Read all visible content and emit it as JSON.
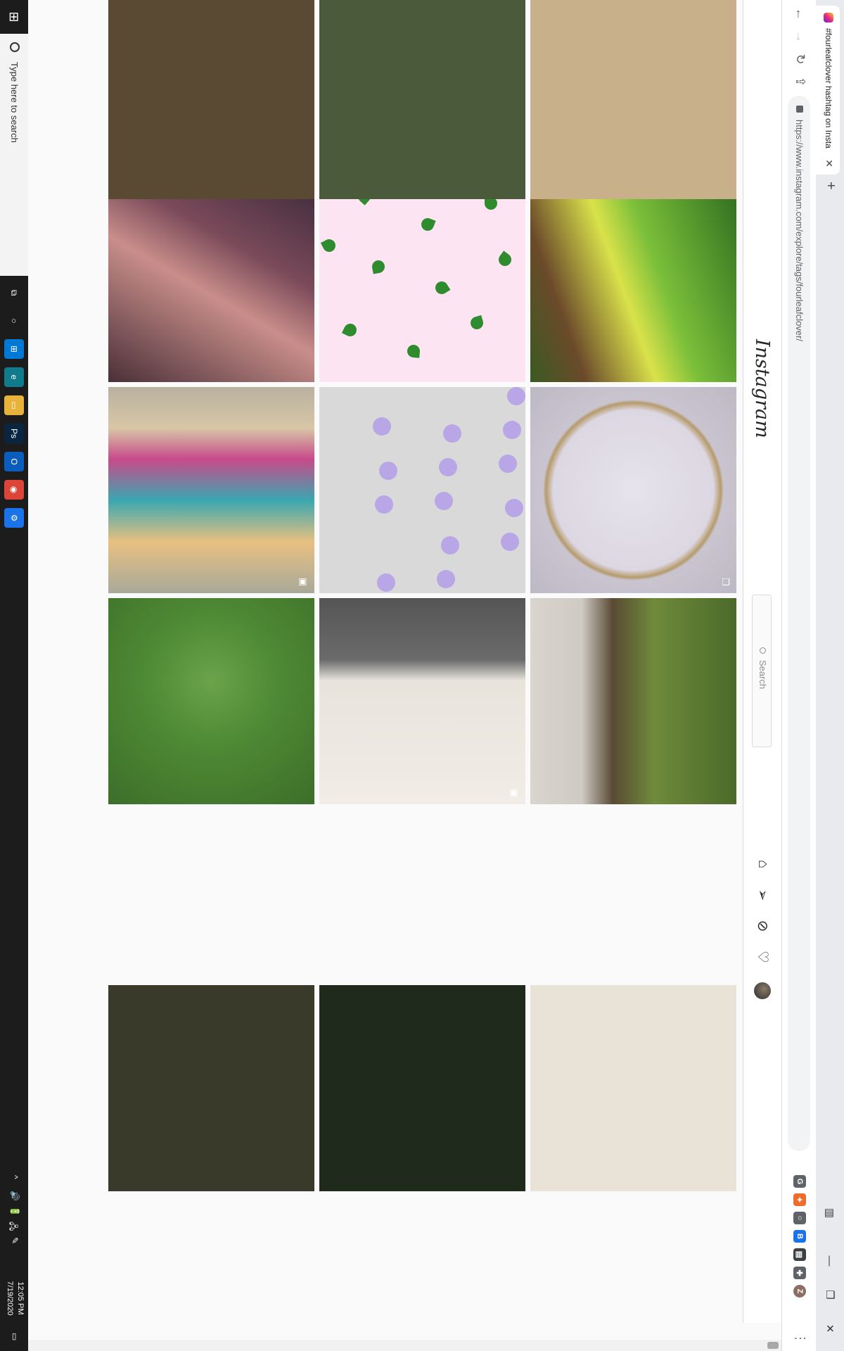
{
  "browser": {
    "tab_title": "#fourleafclover hashtag on Insta",
    "tab_close": "✕",
    "new_tab": "+",
    "url": "https://www.instagram.com/explore/tags/fourleafclover/",
    "window_controls": {
      "minimize": "—",
      "restore": "❐",
      "close": "✕"
    },
    "nav": {
      "back": "←",
      "forward": "→",
      "reload": "↻",
      "share": "⇪"
    },
    "extensions": [
      {
        "name": "extension-g",
        "label": "G",
        "color": "#5f6368"
      },
      {
        "name": "extension-orange",
        "label": "✦",
        "color": "#ef6c2a"
      },
      {
        "name": "extension-circle",
        "label": "○",
        "color": "#5f6368"
      },
      {
        "name": "extension-blue",
        "label": "B",
        "color": "#1a73e8"
      },
      {
        "name": "extension-dark",
        "label": "▤",
        "color": "#3c4043"
      },
      {
        "name": "extensions-puzzle",
        "label": "✚",
        "color": "#5f6368"
      },
      {
        "name": "profile",
        "label": "Z",
        "color": "#8d6e63"
      }
    ],
    "menu": "⋮"
  },
  "instagram": {
    "logo": "Instagram",
    "search_placeholder": "Search",
    "nav_icons": [
      "home-icon",
      "direct-icon",
      "explore-icon",
      "activity-icon",
      "profile-avatar"
    ]
  },
  "posts": [
    {
      "name": "post-selfie-woman",
      "glyph": "",
      "bg": "linear-gradient(120deg,#3b2a3a 0%,#7a4a5a 35%,#c98e8a 55%,#4a3038 100%)"
    },
    {
      "name": "post-clover-pattern-pink",
      "glyph": "",
      "bg": "#fde4f2"
    },
    {
      "name": "post-man-in-plants",
      "glyph": "",
      "bg": "linear-gradient(160deg,#2f6b1f 0%,#7bbf3a 40%,#d9e24a 55%,#6b4a2a 80%,#3b5a22 100%)"
    },
    {
      "name": "post-group-photo",
      "glyph": "▣",
      "bg": "linear-gradient(90deg,#b9b1a0 0%,#d8c6a6 20%,#c84a8a 35%,#3aa7b0 55%,#e8c080 75%,#a8a99a 100%)"
    },
    {
      "name": "post-pandora-castle",
      "glyph": "",
      "bg": "#d9d9d9"
    },
    {
      "name": "post-speckled-plate",
      "glyph": "❐",
      "bg": "radial-gradient(circle at 50% 50%,#e6e3ec 0%,#dcd7e2 55%,#b59a6a 60%,#c9c4cf 62%,#bdb9c4 100%)"
    },
    {
      "name": "post-clovers-in-hand",
      "glyph": "",
      "bg": "radial-gradient(circle at 40% 50%,#6aa34a 0%,#4f8a34 40%,#3c6e2a 100%)"
    },
    {
      "name": "post-framed-bird-art",
      "glyph": "▣",
      "bg": "linear-gradient(90deg,#555 0%,#6b6b6b 30%,#e8e4dc 40%,#f1ece6 100%)"
    },
    {
      "name": "post-clover-on-ground",
      "glyph": "",
      "bg": "linear-gradient(180deg,#4b6a2a 0%,#6f8a3a 40%,#5a4a34 60%,#cfcac4 75%,#d9d4ce 100%)"
    }
  ],
  "taskbar": {
    "search_placeholder": "Type here to search",
    "time": "12:05 PM",
    "date": "7/19/2020",
    "apps": [
      {
        "name": "task-view-icon",
        "label": "⧉",
        "color": "transparent"
      },
      {
        "name": "cortana-icon",
        "label": "○",
        "color": "transparent"
      },
      {
        "name": "store-icon",
        "label": "⊞",
        "color": "#0078d4"
      },
      {
        "name": "edge-icon",
        "label": "e",
        "color": "#0f7b8b"
      },
      {
        "name": "file-explorer-icon",
        "label": "▭",
        "color": "#e8b33a"
      },
      {
        "name": "photoshop-icon",
        "label": "Ps",
        "color": "#0a2540"
      },
      {
        "name": "outlook-icon",
        "label": "O",
        "color": "#0a5dbd"
      },
      {
        "name": "chrome-icon",
        "label": "◉",
        "color": "#db4437"
      },
      {
        "name": "settings-app-icon",
        "label": "⚙",
        "color": "#1a73e8"
      }
    ],
    "tray": [
      "^",
      "🔊",
      "🔋",
      "🖧",
      "✎"
    ]
  }
}
